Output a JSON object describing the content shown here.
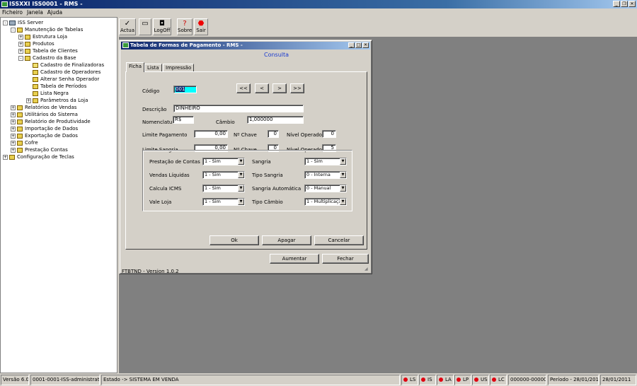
{
  "app": {
    "title": "ISSXXI ISS0001 - RMS -"
  },
  "menu": [
    "Ficheiro",
    "Janela",
    "Ajuda"
  ],
  "tree": [
    {
      "label": "ISS Server",
      "depth": 0,
      "expander": "-",
      "icon": "computer-icon"
    },
    {
      "label": "Manutenção de Tabelas",
      "depth": 1,
      "expander": "-",
      "icon": "folder-icon"
    },
    {
      "label": "Estrutura Loja",
      "depth": 2,
      "expander": "+",
      "icon": "folder-icon"
    },
    {
      "label": "Produtos",
      "depth": 2,
      "expander": "+",
      "icon": "folder-icon"
    },
    {
      "label": "Tabela de Clientes",
      "depth": 2,
      "expander": "+",
      "icon": "folder-icon"
    },
    {
      "label": "Cadastro da Base",
      "depth": 2,
      "expander": "-",
      "icon": "folder-icon"
    },
    {
      "label": "Cadastro de Finalizadoras",
      "depth": 3,
      "expander": "",
      "icon": "folder-open-icon",
      "selected": true
    },
    {
      "label": "Cadastro de Operadores",
      "depth": 3,
      "expander": "",
      "icon": "folder-icon"
    },
    {
      "label": "Alterar Senha Operador",
      "depth": 3,
      "expander": "",
      "icon": "folder-icon"
    },
    {
      "label": "Tabela de Períodos",
      "depth": 3,
      "expander": "",
      "icon": "folder-icon"
    },
    {
      "label": "Lista Negra",
      "depth": 3,
      "expander": "",
      "icon": "folder-icon"
    },
    {
      "label": "Parâmetros da Loja",
      "depth": 3,
      "expander": "+",
      "icon": "folder-icon"
    },
    {
      "label": "Relatórios de Vendas",
      "depth": 1,
      "expander": "+",
      "icon": "folder-icon"
    },
    {
      "label": "Utilitários do Sistema",
      "depth": 1,
      "expander": "+",
      "icon": "folder-icon"
    },
    {
      "label": "Relatório de Produtividade",
      "depth": 1,
      "expander": "+",
      "icon": "folder-icon"
    },
    {
      "label": "Importação de Dados",
      "depth": 1,
      "expander": "+",
      "icon": "folder-icon"
    },
    {
      "label": "Exportação de Dados",
      "depth": 1,
      "expander": "+",
      "icon": "folder-icon"
    },
    {
      "label": "Cofre",
      "depth": 1,
      "expander": "+",
      "icon": "folder-icon"
    },
    {
      "label": "Prestação Contas",
      "depth": 1,
      "expander": "+",
      "icon": "folder-icon"
    },
    {
      "label": "Configuração de Teclas",
      "depth": 0,
      "expander": "+",
      "icon": "folder-icon"
    }
  ],
  "toolbar": {
    "actua": "Actua",
    "logoff": "LogOff",
    "sobre": "Sobre",
    "sair": "Sair"
  },
  "dialog": {
    "title": "Tabela de Formas de Pagamento - RMS -",
    "mode": "Consulta",
    "tabs": [
      "Ficha",
      "Lista",
      "Impressão"
    ],
    "codigo": {
      "label": "Código",
      "value": "001"
    },
    "nav": [
      "<<",
      "<",
      ">",
      ">>"
    ],
    "descricao": {
      "label": "Descrição",
      "value": "DINHEIRO"
    },
    "nomenclatura": {
      "label": "Nomenclatura",
      "value": "R$"
    },
    "cambio": {
      "label": "Câmbio",
      "value": "1,000000"
    },
    "limite_pagamento": {
      "label": "Limite Pagamento",
      "value": "0,00"
    },
    "limite_sangria": {
      "label": "Limite Sangria",
      "value": "0,00"
    },
    "nchave1": {
      "label": "Nº Chave",
      "value": "0"
    },
    "nchave2": {
      "label": "Nº Chave",
      "value": "0"
    },
    "nivel1": {
      "label": "Nível Operador",
      "value": "0"
    },
    "nivel2": {
      "label": "Nível Operador",
      "value": "5"
    },
    "options_left": [
      {
        "label": "Prestação de Contas",
        "value": "1 - Sim"
      },
      {
        "label": "Vendas Líquidas",
        "value": "1 - Sim"
      },
      {
        "label": "Calcula ICMS",
        "value": "1 - Sim"
      },
      {
        "label": "Vale Loja",
        "value": "1 - Sim"
      }
    ],
    "options_right": [
      {
        "label": "Sangria",
        "value": "1 - Sim"
      },
      {
        "label": "Tipo Sangria",
        "value": "0 - Interna"
      },
      {
        "label": "Sangria Automática",
        "value": "0 - Manual"
      },
      {
        "label": "Tipo Câmbio",
        "value": "1 - Multiplicação"
      }
    ],
    "buttons": {
      "ok": "Ok",
      "apagar": "Apagar",
      "cancelar": "Cancelar",
      "aumentar": "Aumentar",
      "fechar": "Fechar"
    },
    "version": "FTBTND - Version 1.0.2"
  },
  "status": {
    "versao": "Versão 6.0",
    "user": "0001-0001-ISS-administrator",
    "estado": "Estado -> SISTEMA EM VENDA",
    "indicators": [
      "LS",
      "IS",
      "LA",
      "LP",
      "US",
      "LC"
    ],
    "code": "000000-000000",
    "periodo": "Período - 28/01/2011",
    "date": "28/01/2011"
  }
}
